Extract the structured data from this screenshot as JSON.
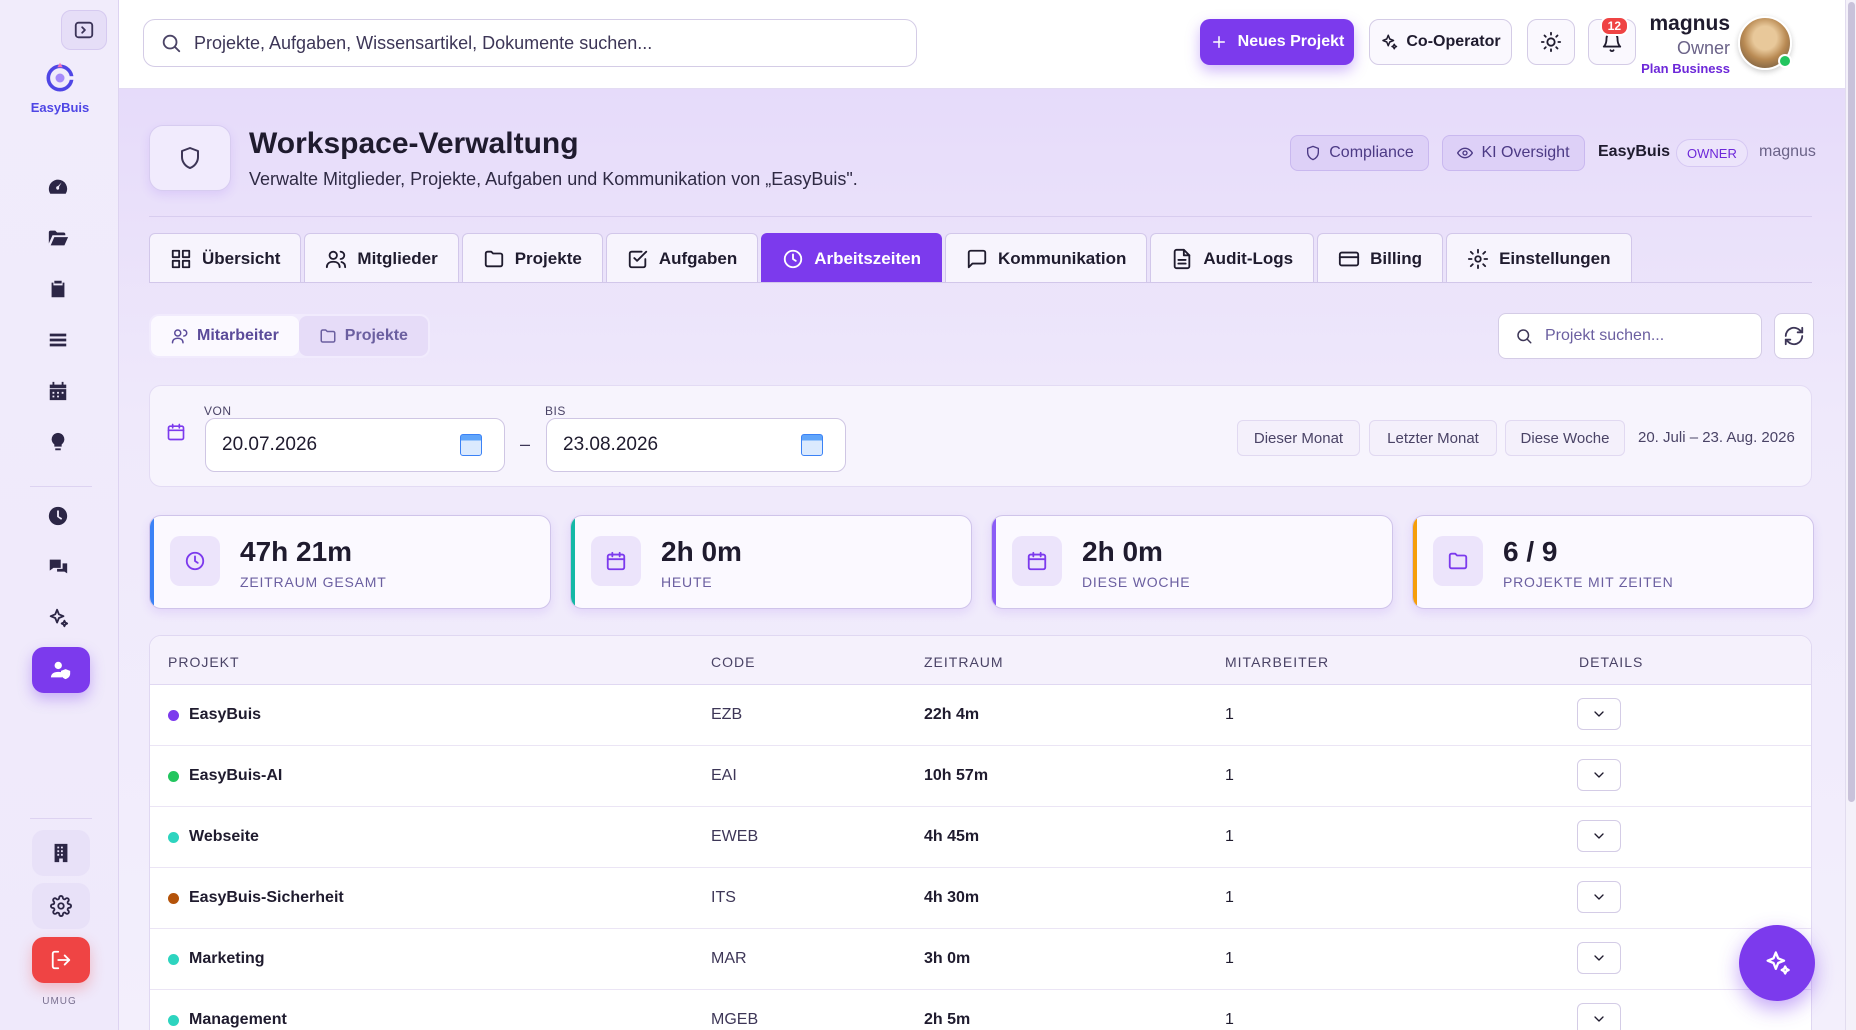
{
  "app": {
    "brand": "EasyBuis",
    "sidebar_footer": "UMUG"
  },
  "topbar": {
    "search_placeholder": "Projekte, Aufgaben, Wissensartikel, Dokumente suchen...",
    "new_project_label": "Neues Projekt",
    "cooperator_label": "Co-Operator",
    "notification_count": "12",
    "user": {
      "name": "magnus",
      "role": "Owner",
      "plan": "Plan Business"
    }
  },
  "header": {
    "title": "Workspace-Verwaltung",
    "subtitle": "Verwalte Mitglieder, Projekte, Aufgaben und Kommunikation von „EasyBuis\".",
    "compliance_label": "Compliance",
    "ki_oversight_label": "KI Oversight",
    "workspace_name": "EasyBuis",
    "owner_badge": "OWNER",
    "username": "magnus"
  },
  "tabs": [
    {
      "label": "Übersicht",
      "icon": "grid-icon"
    },
    {
      "label": "Mitglieder",
      "icon": "users-icon"
    },
    {
      "label": "Projekte",
      "icon": "folder-icon"
    },
    {
      "label": "Aufgaben",
      "icon": "checkbox-icon"
    },
    {
      "label": "Arbeitszeiten",
      "icon": "clock-icon",
      "active": true
    },
    {
      "label": "Kommunikation",
      "icon": "message-icon"
    },
    {
      "label": "Audit-Logs",
      "icon": "file-icon"
    },
    {
      "label": "Billing",
      "icon": "credit-card-icon"
    },
    {
      "label": "Einstellungen",
      "icon": "gear-icon"
    }
  ],
  "view_toggle": {
    "employees": "Mitarbeiter",
    "projects": "Projekte",
    "selected": "Projekte"
  },
  "project_search_placeholder": "Projekt suchen...",
  "date_filter": {
    "from_label": "VON",
    "from_value": "20.07.2026",
    "to_label": "BIS",
    "to_value": "23.08.2026",
    "separator": "–",
    "quick": [
      "Dieser Monat",
      "Letzter Monat",
      "Diese Woche"
    ],
    "range_text": "20. Juli – 23. Aug. 2026"
  },
  "stats": [
    {
      "value": "47h 21m",
      "label": "ZEITRAUM GESAMT",
      "icon": "clock-icon",
      "accent": "#3b82f6"
    },
    {
      "value": "2h 0m",
      "label": "HEUTE",
      "icon": "calendar-icon",
      "accent": "#14b8a6"
    },
    {
      "value": "2h 0m",
      "label": "DIESE WOCHE",
      "icon": "calendar-icon",
      "accent": "#8b5cf6"
    },
    {
      "value": "6 / 9",
      "label": "PROJEKTE MIT ZEITEN",
      "icon": "folder-icon",
      "accent": "#f59e0b"
    }
  ],
  "table": {
    "columns": [
      "PROJEKT",
      "CODE",
      "ZEITRAUM",
      "MITARBEITER",
      "DETAILS"
    ],
    "rows": [
      {
        "name": "EasyBuis",
        "code": "EZB",
        "time": "22h 4m",
        "members": "1",
        "color": "#7c3aed"
      },
      {
        "name": "EasyBuis-AI",
        "code": "EAI",
        "time": "10h 57m",
        "members": "1",
        "color": "#22c55e"
      },
      {
        "name": "Webseite",
        "code": "EWEB",
        "time": "4h 45m",
        "members": "1",
        "color": "#2dd4bf"
      },
      {
        "name": "EasyBuis-Sicherheit",
        "code": "ITS",
        "time": "4h 30m",
        "members": "1",
        "color": "#b45309"
      },
      {
        "name": "Marketing",
        "code": "MAR",
        "time": "3h 0m",
        "members": "1",
        "color": "#2dd4bf"
      },
      {
        "name": "Management",
        "code": "MGEB",
        "time": "2h 5m",
        "members": "1",
        "color": "#2dd4bf"
      }
    ]
  },
  "colors": {
    "accent": "#7c3aed",
    "danger": "#ef4444"
  }
}
